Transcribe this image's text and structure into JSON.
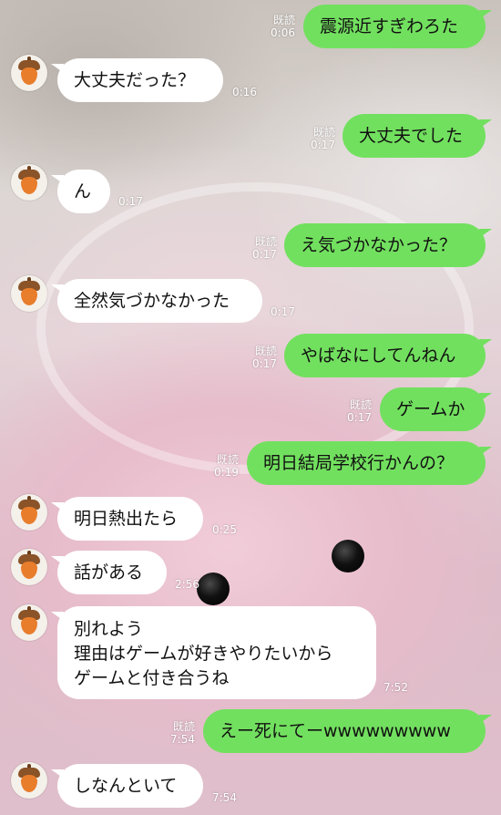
{
  "chat": {
    "read_label": "既読",
    "messages": [
      {
        "dir": "out",
        "text": "震源近すぎわろた",
        "time": "0:06",
        "read": true
      },
      {
        "dir": "in",
        "text": "大丈夫だった？",
        "time": "0:16"
      },
      {
        "dir": "out",
        "text": "大丈夫でした",
        "time": "0:17",
        "read": true
      },
      {
        "dir": "in",
        "text": "ん",
        "time": "0:17"
      },
      {
        "dir": "out",
        "text": "え気づかなかった？",
        "time": "0:17",
        "read": true
      },
      {
        "dir": "in",
        "text": "全然気づかなかった",
        "time": "0:17"
      },
      {
        "dir": "out",
        "text": "やばなにしてんねん",
        "time": "0:17",
        "read": true
      },
      {
        "dir": "out",
        "text": "ゲームか",
        "time": "0:17",
        "read": true
      },
      {
        "dir": "out",
        "text": "明日結局学校行かんの？",
        "time": "0:19",
        "read": true
      },
      {
        "dir": "in",
        "text": "明日熱出たら",
        "time": "0:25"
      },
      {
        "dir": "in",
        "text": "話がある",
        "time": "2:56"
      },
      {
        "dir": "in",
        "lines": [
          "別れよう",
          "理由はゲームが好きやりたいから",
          "ゲームと付き合うね"
        ],
        "time": "7:52"
      },
      {
        "dir": "out",
        "text": "えー死にてーwwwwwwwww",
        "time": "7:54",
        "read": true
      },
      {
        "dir": "in",
        "text": "しなんといて",
        "time": "7:54"
      }
    ]
  },
  "contact": {
    "avatar_icon": "acorn-icon"
  },
  "colors": {
    "outgoing_bubble": "#72e05f",
    "incoming_bubble": "#ffffff",
    "meta_text": "#ffffff"
  }
}
